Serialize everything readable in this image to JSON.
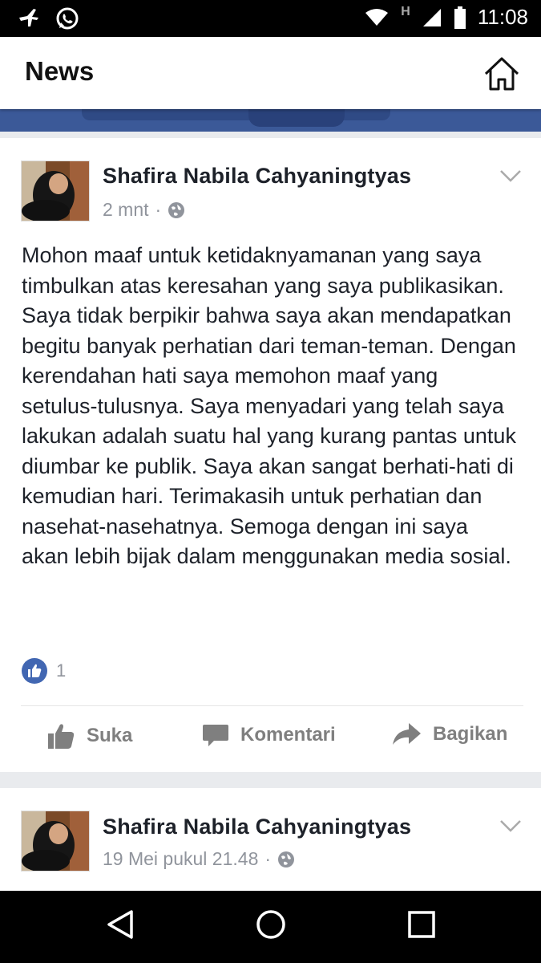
{
  "status_bar": {
    "time": "11:08",
    "network_label": "H",
    "icons": [
      "airplane-like-icon",
      "whatsapp-icon",
      "wifi-icon",
      "signal-icon",
      "battery-icon"
    ]
  },
  "app_bar": {
    "title": "News",
    "home_icon": "home-icon"
  },
  "posts": [
    {
      "author": "Shafira Nabila Cahyaningtyas",
      "time": "2 mnt",
      "privacy_icon": "globe-icon",
      "text": "Mohon maaf untuk ketidaknyamanan yang saya timbulkan atas keresahan yang saya publikasikan. Saya tidak berpikir bahwa saya akan mendapatkan begitu banyak perhatian dari teman-teman. Dengan kerendahan hati saya memohon maaf yang setulus-tulusnya. Saya menyadari yang telah saya lakukan adalah suatu hal yang kurang pantas untuk diumbar ke publik. Saya akan sangat berhati-hati di kemudian hari. Terimakasih untuk perhatian dan nasehat-nasehatnya. Semoga dengan ini saya akan lebih bijak dalam menggunakan media sosial.",
      "like_count": "1",
      "actions": {
        "like": "Suka",
        "comment": "Komentari",
        "share": "Bagikan"
      }
    },
    {
      "author": "Shafira Nabila Cahyaningtyas",
      "time": "19 Mei pukul 21.48",
      "privacy_icon": "globe-icon"
    }
  ],
  "colors": {
    "facebook_blue": "#3b5998",
    "like_blue": "#4267b2",
    "meta_gray": "#90949c",
    "text": "#1d2129"
  }
}
